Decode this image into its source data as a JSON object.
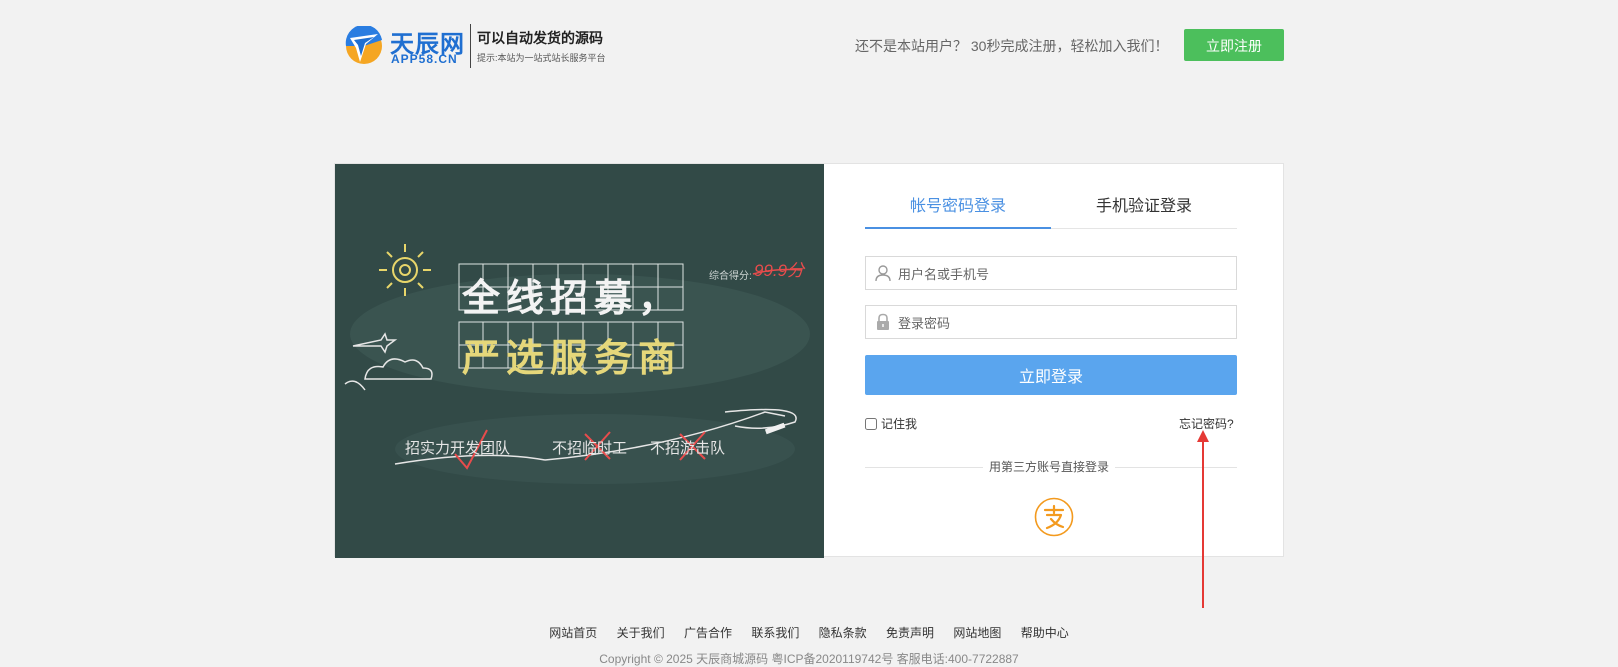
{
  "header": {
    "logo_cn": "天辰网",
    "logo_en": "APP58.CN",
    "slogan": "可以自动发货的源码",
    "tip": "提示:本站为一站式站长服务平台",
    "register_prompt": "还不是本站用户？ 30秒完成注册，轻松加入我们！",
    "register_button": "立即注册",
    "accent_color": "#4cbf5c"
  },
  "banner": {
    "title_line1": "全线招募，",
    "title_line2": "严选服务商",
    "score_label": "综合得分:",
    "score_value": "99.9分",
    "slogans": [
      "招实力开发团队",
      "不招临时工",
      "不招游击队"
    ]
  },
  "login": {
    "tabs": [
      {
        "label": "帐号密码登录",
        "active": true
      },
      {
        "label": "手机验证登录",
        "active": false
      }
    ],
    "username_placeholder": "用户名或手机号",
    "password_placeholder": "登录密码",
    "username_icon": "user-icon",
    "password_icon": "lock-icon",
    "submit_label": "立即登录",
    "remember_label": "记住我",
    "forgot_label": "忘记密码?",
    "third_party_label": "用第三方账号直接登录",
    "third_party_icon": "alipay-icon",
    "accent_color": "#5aa5ee"
  },
  "footer": {
    "links": [
      "网站首页",
      "关于我们",
      "广告合作",
      "联系我们",
      "隐私条款",
      "免责声明",
      "网站地图",
      "帮助中心"
    ],
    "copyright": "Copyright © 2025 天辰商城源码 粤ICP备2020119742号 客服电话:400-7722887"
  }
}
